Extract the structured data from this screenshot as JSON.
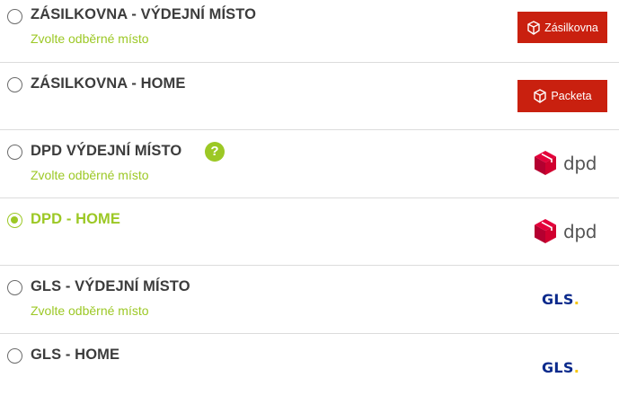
{
  "options": [
    {
      "title": "ZÁSILKOVNA - VÝDEJNÍ MÍSTO",
      "subtitle": "Zvolte odběrné místo",
      "selected": false,
      "logo_text": "Zásilkovna",
      "logo_icon": "packeta-box-icon"
    },
    {
      "title": "ZÁSILKOVNA - HOME",
      "subtitle": "",
      "selected": false,
      "logo_text": "Packeta",
      "logo_icon": "packeta-box-icon"
    },
    {
      "title": "DPD VÝDEJNÍ MÍSTO",
      "subtitle": "Zvolte odběrné místo",
      "selected": false,
      "help": "?",
      "logo_text": "dpd",
      "logo_icon": "dpd-cube-icon"
    },
    {
      "title": "DPD - HOME",
      "subtitle": "",
      "selected": true,
      "logo_text": "dpd",
      "logo_icon": "dpd-cube-icon"
    },
    {
      "title": "GLS - VÝDEJNÍ MÍSTO",
      "subtitle": "Zvolte odběrné místo",
      "selected": false,
      "logo_text": "GLS",
      "logo_dot": ".",
      "logo_icon": "gls-logo"
    },
    {
      "title": "GLS - HOME",
      "subtitle": "",
      "selected": false,
      "logo_text": "GLS",
      "logo_dot": ".",
      "logo_icon": "gls-logo"
    }
  ],
  "colors": {
    "accent_green": "#9cc825",
    "packeta_red": "#c9200f",
    "dpd_red": "#dc0032",
    "gls_blue": "#0a2a8c",
    "gls_yellow": "#f7c600",
    "divider": "#dcdcdc"
  }
}
